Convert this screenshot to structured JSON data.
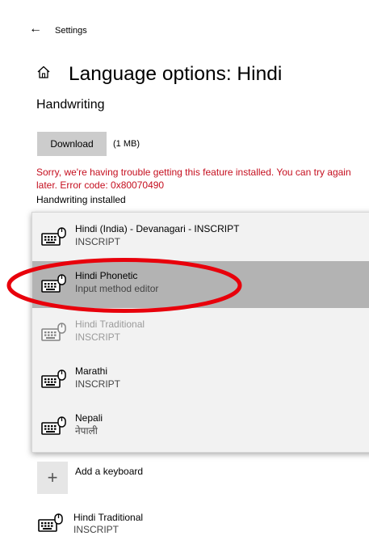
{
  "header": {
    "back_icon": "back-arrow-icon",
    "back_glyph": "←",
    "app_title": "Settings",
    "page_title": "Language options: Hindi",
    "home_icon": "home-icon"
  },
  "handwriting": {
    "section_title": "Handwriting",
    "download_label": "Download",
    "download_size": "(1 MB)",
    "error_message": "Sorry, we're having trouble getting this feature installed. You can try again later. Error code: 0x80070490",
    "installed_status": "Handwriting installed"
  },
  "keyboard_dropdown": {
    "items": [
      {
        "name": "Hindi (India) - Devanagari - INSCRIPT",
        "sub": "INSCRIPT",
        "state": "normal",
        "icon": "keyboard-icon"
      },
      {
        "name": "Hindi Phonetic",
        "sub": "Input method editor",
        "state": "selected",
        "icon": "keyboard-icon"
      },
      {
        "name": "Hindi Traditional",
        "sub": "INSCRIPT",
        "state": "disabled",
        "icon": "keyboard-icon"
      },
      {
        "name": "Marathi",
        "sub": "INSCRIPT",
        "state": "normal",
        "icon": "keyboard-icon"
      },
      {
        "name": "Nepali",
        "sub": "नेपाली",
        "state": "normal",
        "icon": "keyboard-icon"
      }
    ]
  },
  "add_keyboard": {
    "icon": "plus-icon",
    "glyph": "+",
    "label": "Add a keyboard"
  },
  "installed_keyboard": {
    "name": "Hindi Traditional",
    "sub": "INSCRIPT",
    "icon": "keyboard-icon"
  },
  "colors": {
    "error": "#c50f1f",
    "annotation": "#e8000b",
    "selected_bg": "#b3b3b3",
    "dropdown_bg": "#f2f2f2",
    "button_bg": "#cccccc"
  }
}
